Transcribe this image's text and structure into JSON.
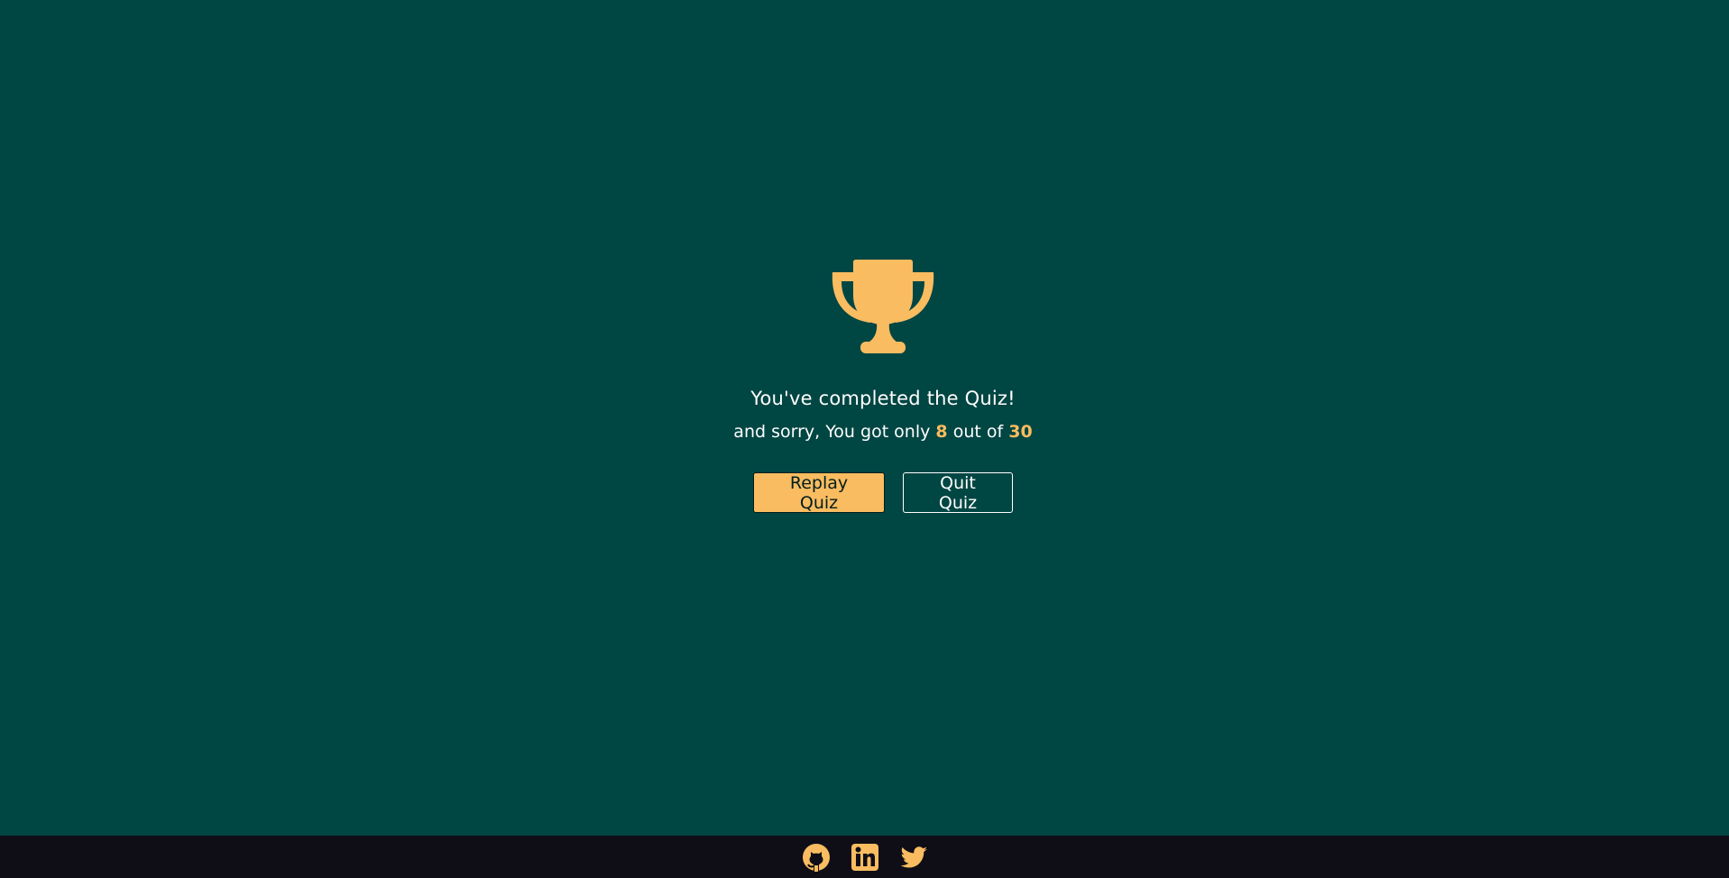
{
  "result": {
    "trophy_icon": "trophy-icon",
    "headline": "You've completed the Quiz!",
    "message_prefix": "and sorry, You got only",
    "score": "8",
    "message_middle": "out of",
    "total": "30"
  },
  "actions": {
    "replay_label": "Replay Quiz",
    "quit_label": "Quit Quiz"
  },
  "footer": {
    "links": [
      {
        "icon": "github-icon"
      },
      {
        "icon": "linkedin-icon"
      },
      {
        "icon": "twitter-icon"
      }
    ]
  },
  "colors": {
    "background": "#004643",
    "accent": "#f9bc60",
    "text": "#fffffe",
    "footer_background": "#0f0e17"
  }
}
